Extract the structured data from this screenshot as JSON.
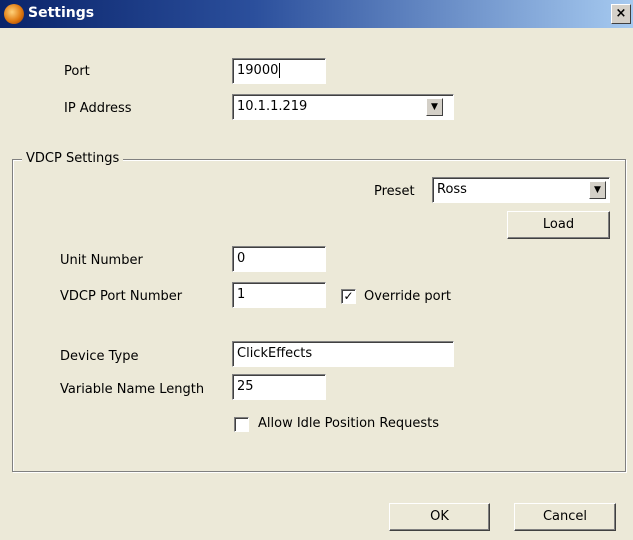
{
  "window": {
    "title": "Settings",
    "close_glyph": "×"
  },
  "connection": {
    "port_label": "Port",
    "port_value": "19000",
    "ip_label": "IP Address",
    "ip_value": "10.1.1.219"
  },
  "vdcp": {
    "group_label": "VDCP Settings",
    "preset_label": "Preset",
    "preset_value": "Ross",
    "load_label": "Load",
    "unit_label": "Unit Number",
    "unit_value": "0",
    "port_label": "VDCP Port Number",
    "port_value": "1",
    "override_label": "Override port",
    "override_checked": true,
    "device_type_label": "Device Type",
    "device_type_value": "ClickEffects",
    "var_len_label": "Variable Name Length",
    "var_len_value": "25",
    "idle_label": "Allow Idle Position Requests",
    "idle_checked": false
  },
  "footer": {
    "ok_label": "OK",
    "cancel_label": "Cancel"
  },
  "icons": {
    "app": "settings-app-icon",
    "dropdown": "chevron-down-icon",
    "check": "check-icon"
  }
}
